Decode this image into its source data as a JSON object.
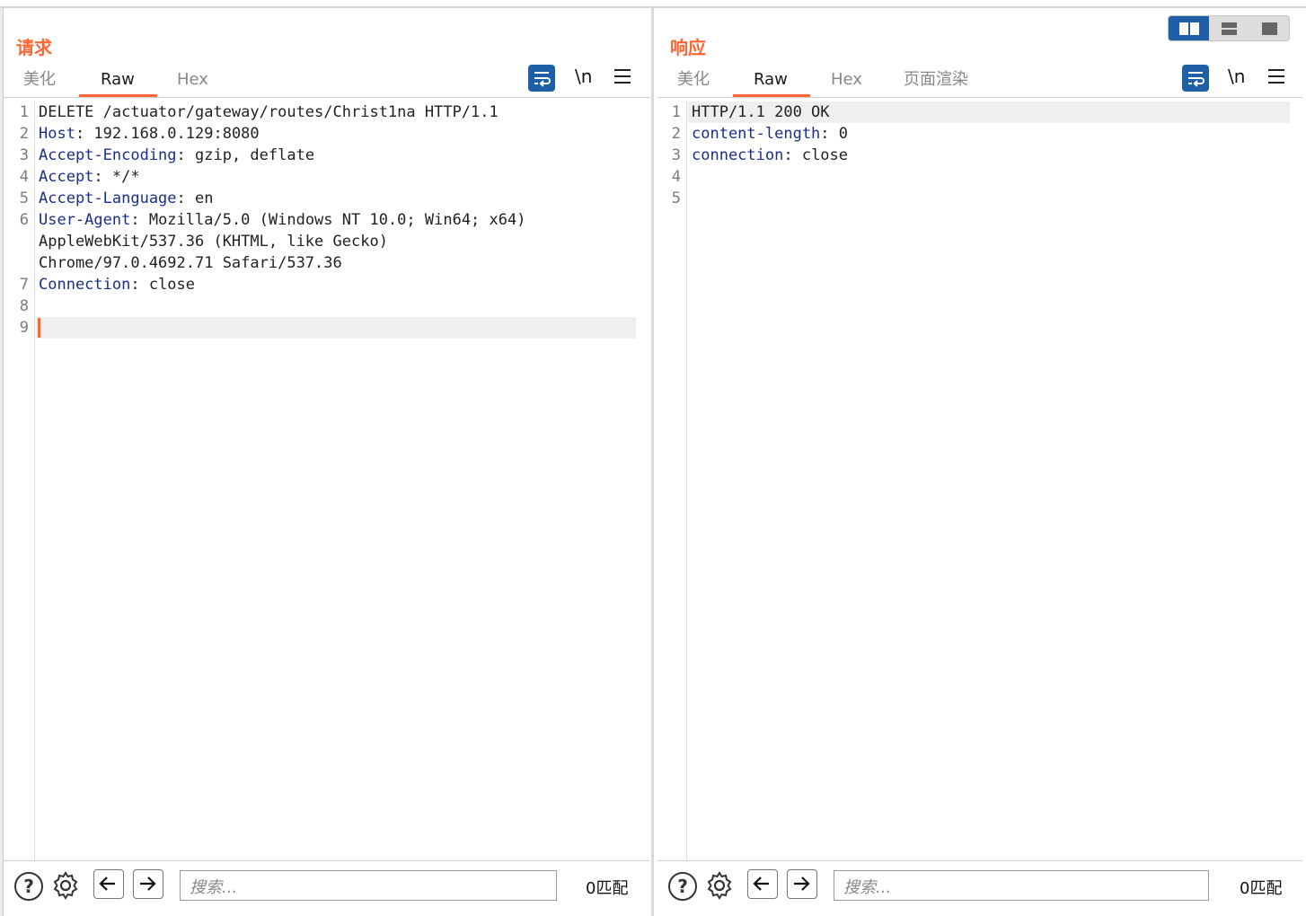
{
  "left": {
    "title": "请求",
    "tabs": [
      {
        "label": "美化",
        "active": false
      },
      {
        "label": "Raw",
        "active": true
      },
      {
        "label": "Hex",
        "active": false
      }
    ],
    "newline_label": "\\n",
    "lines": [
      {
        "num": "1",
        "name": "",
        "value": "DELETE /actuator/gateway/routes/Christ1na HTTP/1.1"
      },
      {
        "num": "2",
        "name": "Host",
        "value": ": 192.168.0.129:8080"
      },
      {
        "num": "3",
        "name": "Accept-Encoding",
        "value": ": gzip, deflate"
      },
      {
        "num": "4",
        "name": "Accept",
        "value": ": */*"
      },
      {
        "num": "5",
        "name": "Accept-Language",
        "value": ": en"
      },
      {
        "num": "6",
        "name": "User-Agent",
        "value": ": Mozilla/5.0 (Windows NT 10.0; Win64; x64)"
      },
      {
        "num": "",
        "name": "",
        "value": "AppleWebKit/537.36 (KHTML, like Gecko)"
      },
      {
        "num": "",
        "name": "",
        "value": "Chrome/97.0.4692.71 Safari/537.36"
      },
      {
        "num": "7",
        "name": "Connection",
        "value": ": close"
      },
      {
        "num": "8",
        "name": "",
        "value": ""
      },
      {
        "num": "9",
        "name": "",
        "value": ""
      }
    ],
    "search_placeholder": "搜索...",
    "matches": "0匹配"
  },
  "right": {
    "title": "响应",
    "tabs": [
      {
        "label": "美化",
        "active": false
      },
      {
        "label": "Raw",
        "active": true
      },
      {
        "label": "Hex",
        "active": false
      },
      {
        "label": "页面渲染",
        "active": false
      }
    ],
    "newline_label": "\\n",
    "lines": [
      {
        "num": "1",
        "name": "",
        "value": "HTTP/1.1 200 OK"
      },
      {
        "num": "2",
        "name": "content-length",
        "value": ": 0"
      },
      {
        "num": "3",
        "name": "connection",
        "value": ": close"
      },
      {
        "num": "4",
        "name": "",
        "value": ""
      },
      {
        "num": "5",
        "name": "",
        "value": ""
      }
    ],
    "search_placeholder": "搜索...",
    "matches": "0匹配"
  },
  "layout_toggle": {
    "active": "side-by-side",
    "options": [
      "side-by-side",
      "top-bottom",
      "single"
    ]
  },
  "colors": {
    "accent": "#ff6633",
    "header_name": "#1a2f8a",
    "button_blue": "#1f5fa8"
  }
}
